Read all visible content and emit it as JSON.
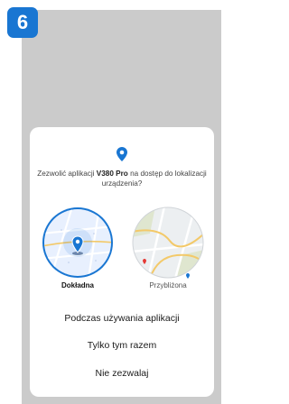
{
  "step_badge": "6",
  "dialog": {
    "prompt_prefix": "Zezwolić aplikacji ",
    "app_name": "V380 Pro",
    "prompt_suffix": " na dostęp do lokalizacji urządzenia?",
    "map_options": [
      {
        "label": "Dokładna",
        "selected": true
      },
      {
        "label": "Przybliżona",
        "selected": false
      }
    ],
    "buttons": {
      "while_using": "Podczas używania aplikacji",
      "only_this_time": "Tylko tym razem",
      "deny": "Nie zezwalaj"
    }
  },
  "colors": {
    "accent": "#1976d2",
    "screen_background": "#cbcbcb",
    "dialog_background": "#ffffff"
  },
  "icons": {
    "dialog_icon": "location-pin-icon",
    "precise_marker": "location-pin-icon",
    "approx_marker": "map-pin-icon"
  }
}
